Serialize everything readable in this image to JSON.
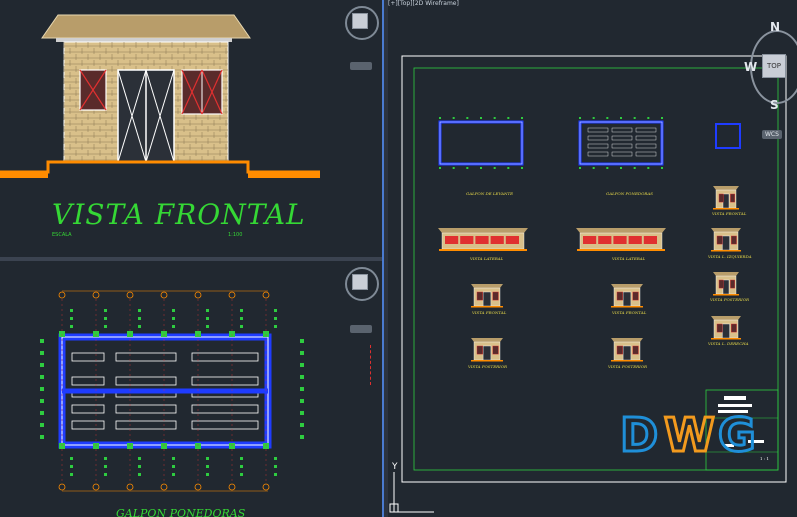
{
  "left_top_viewport": {
    "drawing_title": "VISTA FRONTAL",
    "scale_label": "ESCALA",
    "scale_value": "1:100"
  },
  "left_bottom_viewport": {
    "drawing_title": "GALPON PONEDORAS"
  },
  "right_viewport": {
    "viewport_label": "[+][Top][2D Wireframe]",
    "viewcube_top": "TOP",
    "compass_n": "N",
    "compass_w": "W",
    "compass_s": "S",
    "wcs_label": "WCS",
    "ucs_y": "Y",
    "sheet_labels": {
      "plan1": "GALPON DE LEVANTE",
      "plan2": "GALPON PONEDORAS",
      "elev1": "VISTA LATERAL",
      "elev2": "VISTA LATERAL",
      "front1": "VISTA FRONTAL",
      "front2": "VISTA FRONTAL",
      "post1": "VISTA POSTERIOR",
      "post2": "VISTA POSTERIOR",
      "small_front": "VISTA FRONTAL",
      "small_lateral": "VISTA L. IZQUIERDA",
      "small_post": "VISTA POSTERIOR",
      "small_lateral2": "VISTA L. DERECHA"
    },
    "titleblock_scale": "1 : 1"
  },
  "watermark": {
    "letters": [
      "D",
      "W",
      "G"
    ]
  },
  "colors": {
    "background": "#212830",
    "wall": "#d9c08a",
    "outline": "#ffffff",
    "accent_orange": "#ff8c00",
    "accent_green": "#2ecc40",
    "accent_blue": "#1f3cff",
    "door_red": "#e03030",
    "title_green": "#35d835",
    "watermark_blue": "#1f8fd8",
    "watermark_orange": "#f29a1e"
  }
}
